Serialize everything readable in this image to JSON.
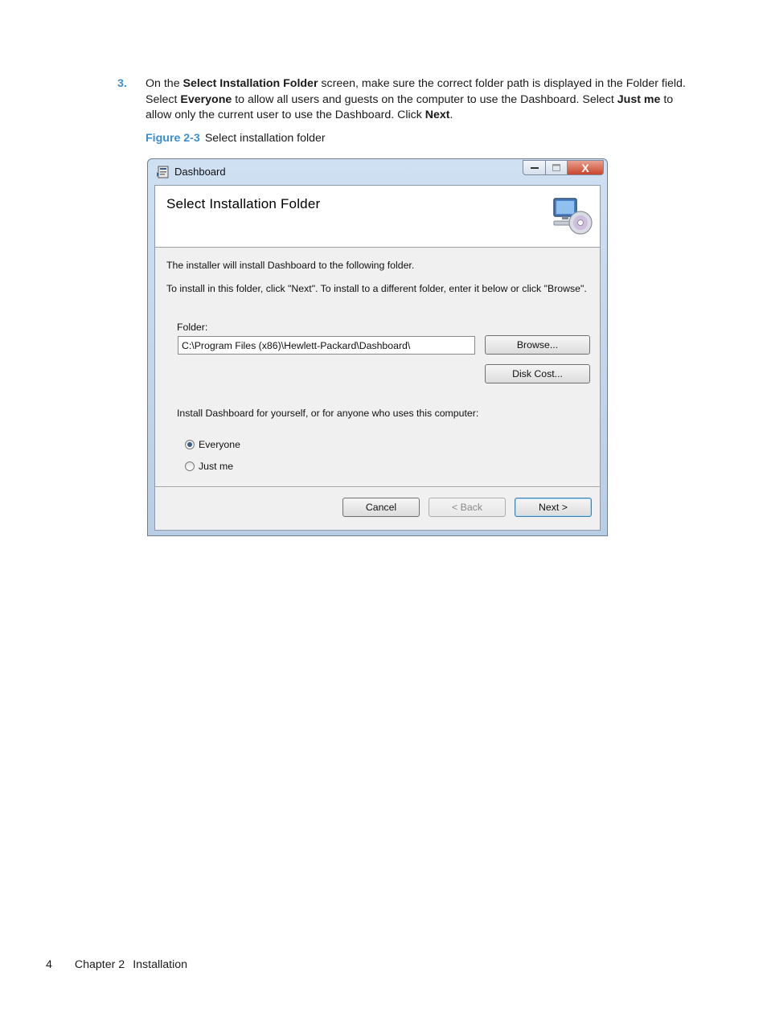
{
  "step": {
    "number": "3.",
    "t1": "On the ",
    "b1": "Select Installation Folder",
    "t2": " screen, make sure the correct folder path is displayed in the Folder field. Select ",
    "b2": "Everyone",
    "t3": " to allow all users and guests on the computer to use the Dashboard. Select ",
    "b3": "Just me",
    "t4": " to allow only the current user to use the Dashboard. Click ",
    "b4": "Next",
    "t5": "."
  },
  "figure": {
    "label": "Figure 2-3",
    "caption": "Select installation folder"
  },
  "window": {
    "title": "Dashboard",
    "close_glyph": "X",
    "banner_title": "Select Installation Folder",
    "intro": "The installer will install Dashboard to the following folder.",
    "instructions": "To install in this folder, click \"Next\". To install to a different folder, enter it below or click \"Browse\".",
    "folder_label": "Folder:",
    "folder_value": "C:\\Program Files (x86)\\Hewlett-Packard\\Dashboard\\",
    "browse_label": "Browse...",
    "disk_cost_label": "Disk Cost...",
    "audience_prompt": "Install Dashboard for yourself, or for anyone who uses this computer:",
    "options": [
      {
        "label": "Everyone",
        "selected": true
      },
      {
        "label": "Just me",
        "selected": false
      }
    ],
    "cancel_label": "Cancel",
    "back_label": "< Back",
    "next_label": "Next >"
  },
  "footer": {
    "page_number": "4",
    "chapter": "Chapter 2",
    "section": "Installation"
  },
  "colors": {
    "accent": "#3a8fd0",
    "close_button": "#c9452c"
  },
  "icons": [
    "installer-icon",
    "computer-disc-icon",
    "minimize-icon",
    "maximize-icon",
    "close-icon"
  ]
}
